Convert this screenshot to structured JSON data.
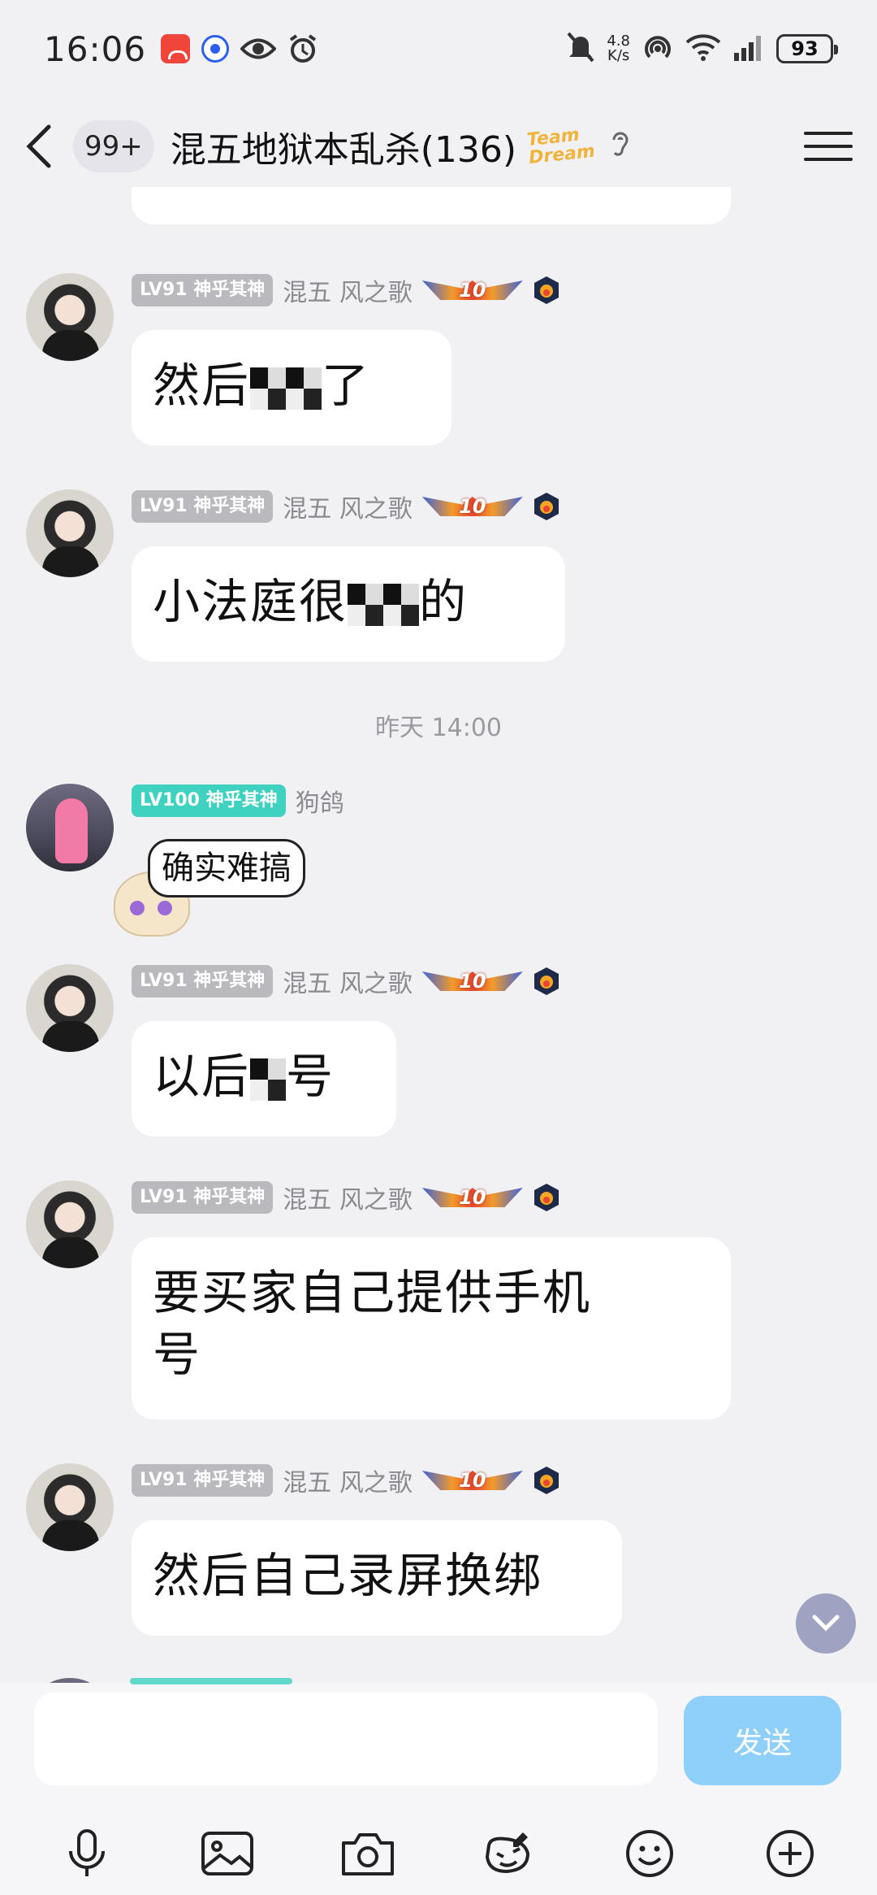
{
  "status_bar": {
    "time": "16:06",
    "net_speed_value": "4.8",
    "net_speed_unit": "K/s",
    "battery": "93"
  },
  "header": {
    "unread_count": "99+",
    "title": "混五地狱本乱杀(136)",
    "team_badge_line1": "Team",
    "team_badge_line2": "Dream"
  },
  "messages": [
    {
      "level": "LV91 神乎其神",
      "nickname": "混五 风之歌",
      "medal": "10",
      "text_before": "然后",
      "text_after": "了"
    },
    {
      "level": "LV91 神乎其神",
      "nickname": "混五 风之歌",
      "medal": "10",
      "text_before": "小法庭很",
      "text_after": "的"
    },
    {
      "separator": "昨天 14:00"
    },
    {
      "level": "LV100 神乎其神",
      "nickname": "狗鸽",
      "sticker_text": "确实难搞"
    },
    {
      "level": "LV91 神乎其神",
      "nickname": "混五 风之歌",
      "medal": "10",
      "text_before": "以后",
      "text_after": "号"
    },
    {
      "level": "LV91 神乎其神",
      "nickname": "混五 风之歌",
      "medal": "10",
      "text_line1": "要买家自己提供手机",
      "text_line2": "号"
    },
    {
      "level": "LV91 神乎其神",
      "nickname": "混五 风之歌",
      "medal": "10",
      "text": "然后自己录屏换绑"
    }
  ],
  "input": {
    "placeholder": "",
    "send_label": "发送"
  },
  "toolbar": {
    "icons": [
      "microphone-icon",
      "image-icon",
      "camera-icon",
      "sticker-edit-icon",
      "emoji-icon",
      "plus-icon"
    ]
  },
  "colors": {
    "background": "#f1f1f4",
    "bubble": "#ffffff",
    "level_gray": "#b9b9be",
    "level_teal": "#3fd2c0",
    "send_button": "#8fd0fb"
  }
}
